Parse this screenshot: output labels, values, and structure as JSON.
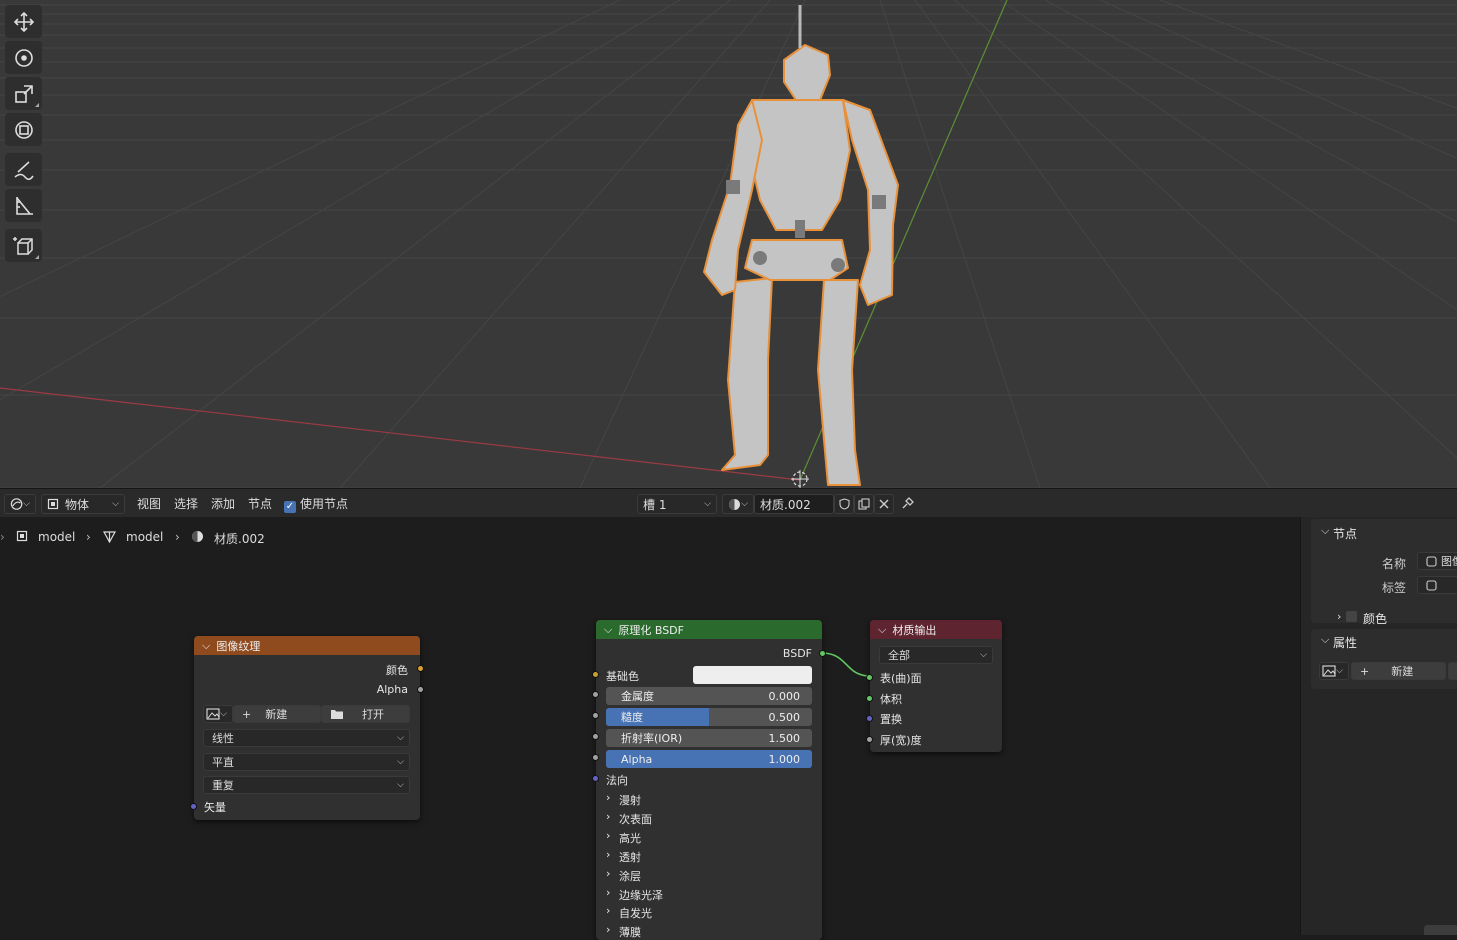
{
  "toolbar_tools": [
    "move-icon",
    "rotate-icon",
    "scale-icon",
    "transform-icon",
    "annotate-icon",
    "measure-icon",
    "add-cube-icon"
  ],
  "header": {
    "mode": "物体",
    "menus": [
      "视图",
      "选择",
      "添加",
      "节点"
    ],
    "use_nodes_label": "使用节点",
    "slot": "槽 1",
    "material_name": "材质.002"
  },
  "breadcrumb": {
    "object": "model",
    "mesh": "model",
    "material": "材质.002"
  },
  "image_texture_node": {
    "title": "图像纹理",
    "out_color": "颜色",
    "out_alpha": "Alpha",
    "new_label": "新建",
    "open_label": "打开",
    "interpolation": "线性",
    "projection": "平直",
    "extension": "重复",
    "in_vector": "矢量",
    "header_color": "#8f4b1e"
  },
  "bsdf_node": {
    "title": "原理化 BSDF",
    "out_bsdf": "BSDF",
    "base_color_label": "基础色",
    "metallic_label": "金属度",
    "metallic_value": "0.000",
    "metallic_fraction": 0,
    "roughness_label": "糙度",
    "roughness_value": "0.500",
    "roughness_fraction": 0.5,
    "ior_label": "折射率(IOR)",
    "ior_value": "1.500",
    "alpha_label": "Alpha",
    "alpha_value": "1.000",
    "alpha_fraction": 1,
    "normal_label": "法向",
    "panels": [
      "漫射",
      "次表面",
      "高光",
      "透射",
      "涂层",
      "边缘光泽",
      "自发光",
      "薄膜"
    ],
    "header_color": "#2a6b2d"
  },
  "output_node": {
    "title": "材质输出",
    "target": "全部",
    "inputs": [
      "表(曲)面",
      "体积",
      "置换",
      "厚(宽)度"
    ],
    "header_color": "#5e2530"
  },
  "side_panel": {
    "node_section": "节点",
    "name_label": "名称",
    "name_value": "图像",
    "label_label": "标签",
    "color_label": "颜色",
    "props_section": "属性",
    "new_label": "新建"
  }
}
